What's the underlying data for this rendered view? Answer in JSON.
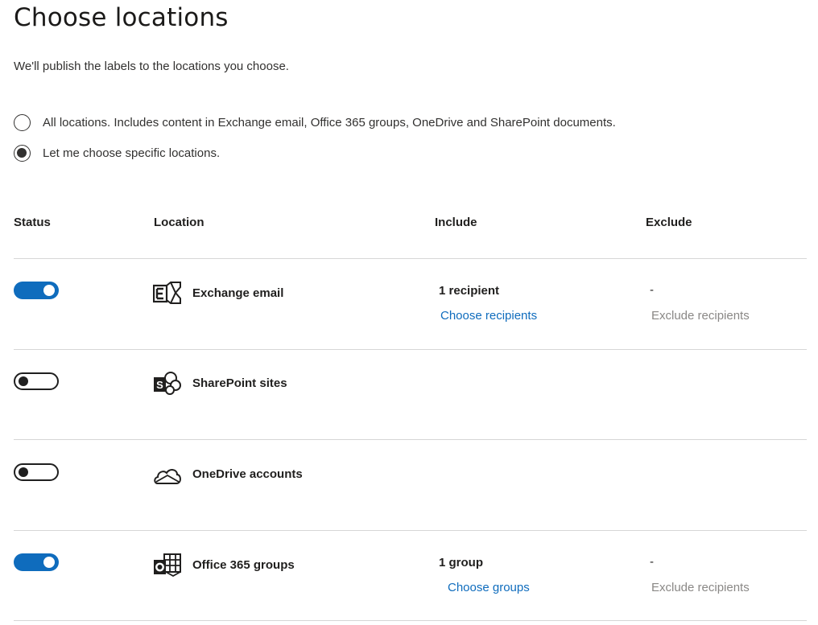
{
  "page": {
    "title": "Choose locations",
    "subtitle": "We'll publish the labels to the locations you choose."
  },
  "options": [
    {
      "label": "All locations. Includes content in Exchange email, Office 365 groups, OneDrive and SharePoint documents.",
      "selected": false
    },
    {
      "label": "Let me choose specific locations.",
      "selected": true
    }
  ],
  "table": {
    "headers": {
      "status": "Status",
      "location": "Location",
      "include": "Include",
      "exclude": "Exclude"
    },
    "rows": [
      {
        "status_on": true,
        "icon": "exchange-icon",
        "location": "Exchange email",
        "include_count": "1 recipient",
        "include_link": "Choose recipients",
        "exclude_value": "-",
        "exclude_link": "Exclude recipients"
      },
      {
        "status_on": false,
        "icon": "sharepoint-icon",
        "location": "SharePoint sites",
        "include_count": "",
        "include_link": "",
        "exclude_value": "",
        "exclude_link": ""
      },
      {
        "status_on": false,
        "icon": "onedrive-icon",
        "location": "OneDrive accounts",
        "include_count": "",
        "include_link": "",
        "exclude_value": "",
        "exclude_link": ""
      },
      {
        "status_on": true,
        "icon": "office365-groups-icon",
        "location": "Office 365 groups",
        "include_count": "1 group",
        "include_link": "Choose groups",
        "exclude_value": "-",
        "exclude_link": "Exclude recipients"
      }
    ]
  },
  "colors": {
    "accent": "#0f6cbd",
    "muted_link": "#8a8886",
    "divider": "#d6d6d6"
  }
}
